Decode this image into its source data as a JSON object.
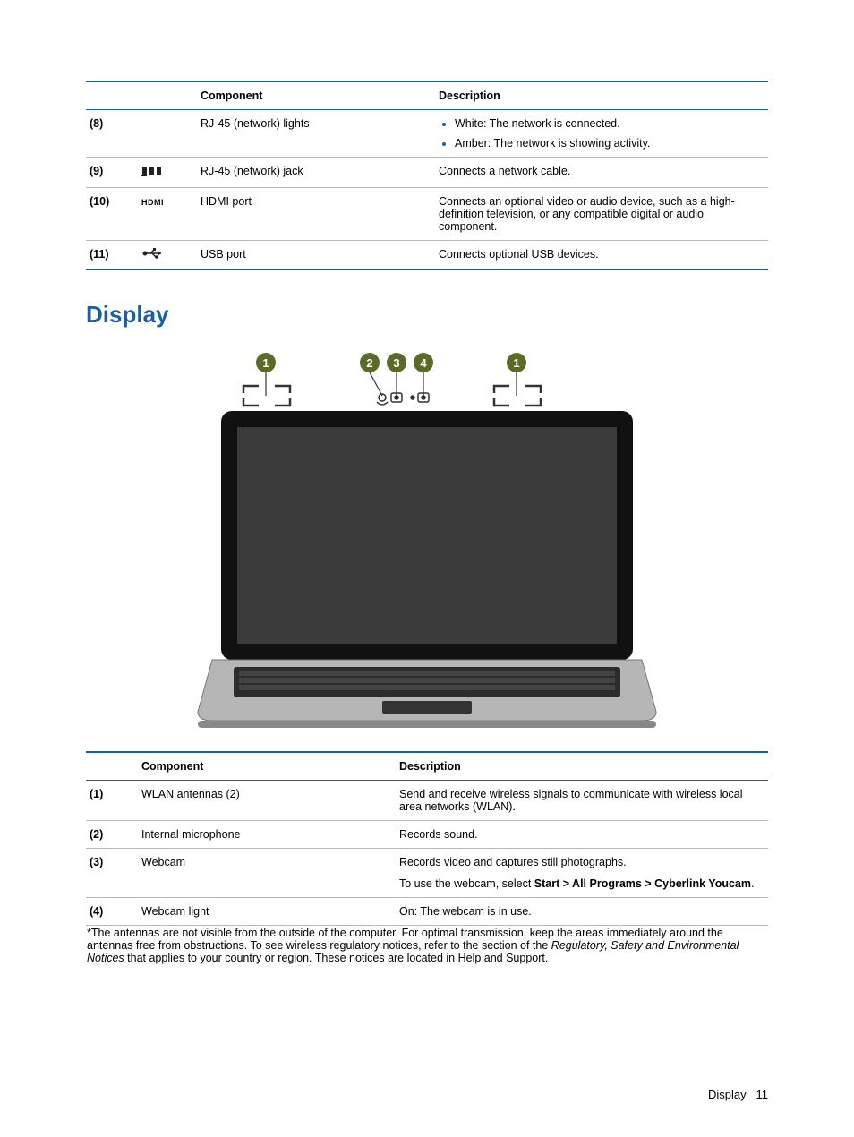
{
  "table1": {
    "headers": {
      "component": "Component",
      "description": "Description"
    },
    "rows": [
      {
        "num": "(8)",
        "component": "RJ-45 (network) lights",
        "bullets": [
          "White: The network is connected.",
          "Amber: The network is showing activity."
        ]
      },
      {
        "num": "(9)",
        "component": "RJ-45 (network) jack",
        "description": "Connects a network cable."
      },
      {
        "num": "(10)",
        "component": "HDMI port",
        "description": "Connects an optional video or audio device, such as a high-definition television, or any compatible digital or audio component."
      },
      {
        "num": "(11)",
        "component": "USB port",
        "description": "Connects optional USB devices."
      }
    ]
  },
  "section_heading": "Display",
  "table2": {
    "headers": {
      "component": "Component",
      "description": "Description"
    },
    "rows": [
      {
        "num": "(1)",
        "component": "WLAN antennas (2)",
        "description": "Send and receive wireless signals to communicate with wireless local area networks (WLAN)."
      },
      {
        "num": "(2)",
        "component": "Internal microphone",
        "description": "Records sound."
      },
      {
        "num": "(3)",
        "component": "Webcam",
        "desc_a": "Records video and captures still photographs.",
        "desc_b_prefix": "To use the webcam, select ",
        "desc_b_bold": "Start > All Programs > Cyberlink Youcam",
        "desc_b_suffix": "."
      },
      {
        "num": "(4)",
        "component": "Webcam light",
        "description": "On: The webcam is in use."
      }
    ],
    "footnote_prefix": "*The antennas are not visible from the outside of the computer. For optimal transmission, keep the areas immediately around the antennas free from obstructions. To see wireless regulatory notices, refer to the section of the ",
    "footnote_italic": "Regulatory, Safety and Environmental Notices",
    "footnote_suffix": " that applies to your country or region. These notices are located in Help and Support."
  },
  "footer": {
    "label": "Display",
    "page": "11"
  },
  "icons": {
    "hdmi": "HDMI"
  }
}
